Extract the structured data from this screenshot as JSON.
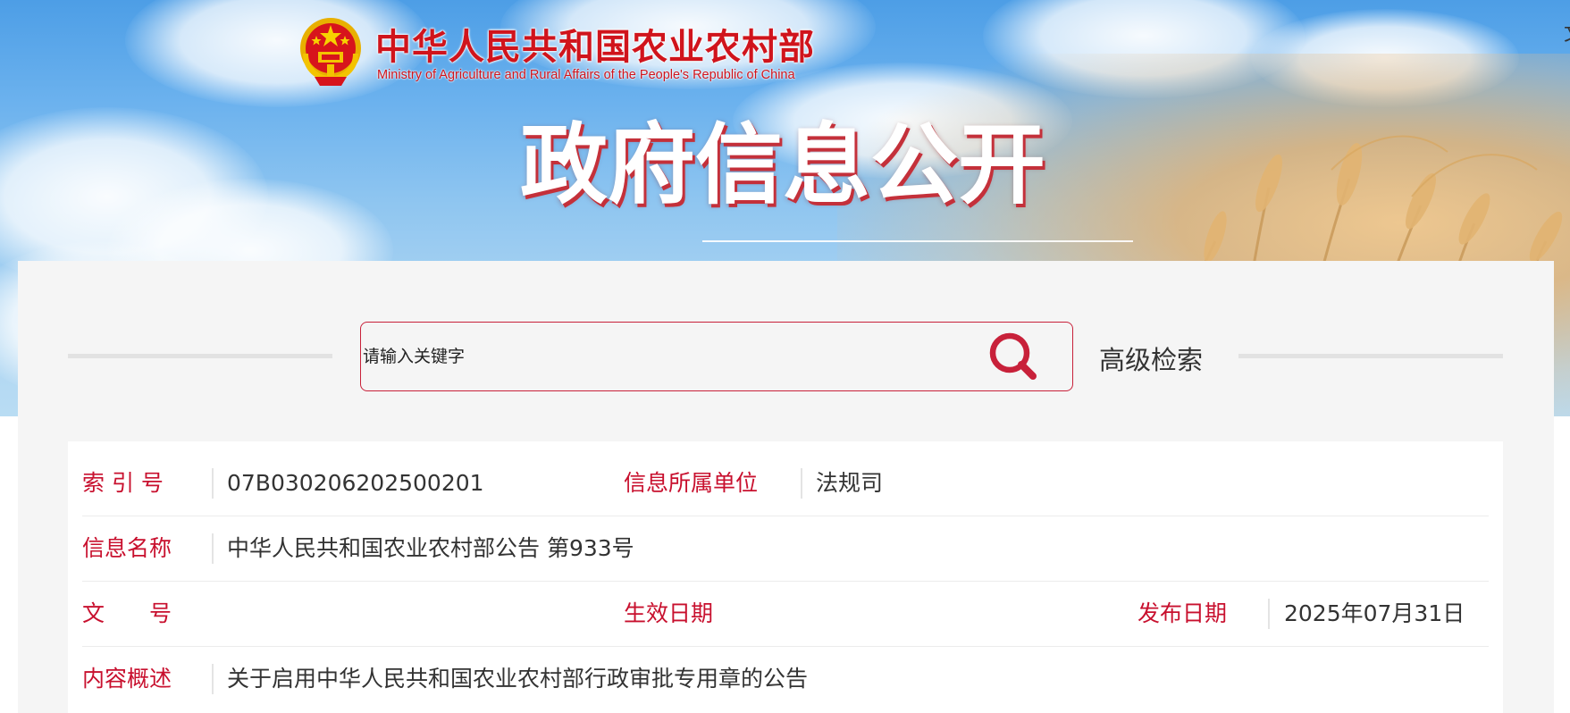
{
  "header": {
    "site_name_cn": "中华人民共和国农业农村部",
    "site_name_en": "Ministry of Agriculture and Rural Affairs of the People's Republic of China",
    "banner_title": "政府信息公开",
    "edge_char": "文"
  },
  "search": {
    "placeholder": "请输入关键字",
    "advanced_label": "高级检索"
  },
  "info": {
    "index_no": {
      "label": "索 引 号",
      "value": "07B030206202500201"
    },
    "dept": {
      "label": "信息所属单位",
      "value": "法规司"
    },
    "name": {
      "label": "信息名称",
      "value": "中华人民共和国农业农村部公告 第933号"
    },
    "doc_no": {
      "label": "文　　号",
      "value": ""
    },
    "effective_date": {
      "label": "生效日期",
      "value": ""
    },
    "publish_date": {
      "label": "发布日期",
      "value": "2025年07月31日"
    },
    "summary": {
      "label": "内容概述",
      "value": "关于启用中华人民共和国农业农村部行政审批专用章的公告"
    }
  },
  "colors": {
    "accent_red": "#c8102e",
    "title_shadow": "#c4303a",
    "panel_bg": "#f5f5f5"
  },
  "icons": {
    "emblem": "national-emblem-icon",
    "search": "magnifier-icon"
  }
}
